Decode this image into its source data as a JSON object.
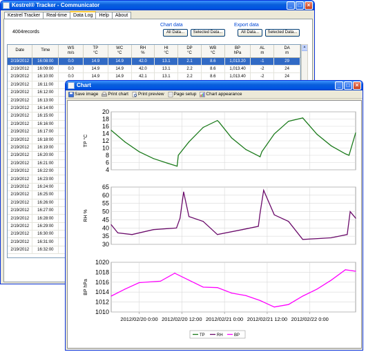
{
  "main_window": {
    "title": "Kestrel® Tracker - Communicator",
    "tabs": [
      "Kestrel Tracker",
      "Real-time",
      "Data Log",
      "Help",
      "About"
    ],
    "active_tab": "Data Log",
    "record_count": "4004records",
    "chart_data_label": "Chart data",
    "export_data_label": "Export data",
    "buttons": {
      "chart_all": "All Data...",
      "chart_selected": "Selected Data...",
      "export_all": "All Data...",
      "export_selected": "Selected Data..."
    },
    "table": {
      "columns": [
        "Date",
        "Time",
        "WS\nm/s",
        "TP\n°C",
        "WC\n°C",
        "RH\n%",
        "HI\n°C",
        "DP\n°C",
        "WB\n°C",
        "BP\nhPa",
        "AL\nm",
        "DA\nm"
      ],
      "rows": [
        [
          "2/19/2012",
          "16:08:00",
          "0.0",
          "14.9",
          "14.9",
          "42.0",
          "13.1",
          "2.1",
          "8.6",
          "1,013.20",
          "-1",
          "29"
        ],
        [
          "2/19/2012",
          "16:09:00",
          "0.0",
          "14.9",
          "14.9",
          "42.0",
          "13.1",
          "2.2",
          "8.6",
          "1,013.40",
          "-2",
          "24"
        ],
        [
          "2/19/2012",
          "16:10:00",
          "0.0",
          "14.9",
          "14.9",
          "42.1",
          "13.1",
          "2.2",
          "8.6",
          "1,013.40",
          "-2",
          "24"
        ],
        [
          "2/19/2012",
          "16:11:00"
        ],
        [
          "2/19/2012",
          "16:12:00"
        ],
        [
          "2/19/2012",
          "16:13:00"
        ],
        [
          "2/19/2012",
          "16:14:00"
        ],
        [
          "2/19/2012",
          "16:15:00"
        ],
        [
          "2/19/2012",
          "16:16:00"
        ],
        [
          "2/19/2012",
          "16:17:00"
        ],
        [
          "2/19/2012",
          "16:18:00"
        ],
        [
          "2/19/2012",
          "16:19:00"
        ],
        [
          "2/19/2012",
          "16:20:00"
        ],
        [
          "2/19/2012",
          "16:21:00"
        ],
        [
          "2/19/2012",
          "16:22:00"
        ],
        [
          "2/19/2012",
          "16:23:00"
        ],
        [
          "2/19/2012",
          "16:24:00"
        ],
        [
          "2/19/2012",
          "16:25:00"
        ],
        [
          "2/19/2012",
          "16:26:00"
        ],
        [
          "2/19/2012",
          "16:27:00"
        ],
        [
          "2/19/2012",
          "16:28:00"
        ],
        [
          "2/19/2012",
          "16:29:00"
        ],
        [
          "2/19/2012",
          "16:30:00"
        ],
        [
          "2/19/2012",
          "16:31:00"
        ],
        [
          "2/19/2012",
          "16:32:00"
        ]
      ]
    }
  },
  "chart_window": {
    "title": "Chart",
    "toolbar": [
      "Save image",
      "Print chart",
      "Print preview",
      "Page setup",
      "Chart appearance"
    ]
  },
  "colors": {
    "tp": "#1a7a1a",
    "rh": "#6a0a6a",
    "bp": "#ff00ff"
  },
  "chart_data": [
    {
      "type": "line",
      "ylabel": "TP °C",
      "ylim": [
        4,
        20
      ],
      "yticks": [
        4,
        6,
        8,
        10,
        12,
        14,
        16,
        18,
        20
      ],
      "x_range": [
        "2012-02-19 16:08",
        "2012-02-22 12:52"
      ],
      "series": [
        {
          "name": "TP",
          "x": [
            "2012-02-19 16:08",
            "2012-02-19 20:00",
            "2012-02-20 00:00",
            "2012-02-20 04:00",
            "2012-02-20 08:00",
            "2012-02-20 10:40",
            "2012-02-20 11:00",
            "2012-02-20 14:00",
            "2012-02-20 18:00",
            "2012-02-20 22:00",
            "2012-02-20 22:30",
            "2012-02-21 02:00",
            "2012-02-21 06:00",
            "2012-02-21 10:00",
            "2012-02-21 10:30",
            "2012-02-21 14:00",
            "2012-02-21 18:00",
            "2012-02-21 22:00",
            "2012-02-22 02:00",
            "2012-02-22 06:00",
            "2012-02-22 10:00",
            "2012-02-22 11:00",
            "2012-02-22 12:52"
          ],
          "y": [
            14.9,
            11.7,
            9.0,
            7.1,
            5.8,
            5.0,
            8.0,
            11.7,
            15.7,
            17.6,
            17.1,
            12.8,
            9.6,
            7.6,
            9.0,
            13.9,
            17.4,
            18.3,
            13.8,
            10.6,
            8.4,
            8.0,
            14.2
          ]
        }
      ]
    },
    {
      "type": "line",
      "ylabel": "RH %",
      "ylim": [
        30,
        65
      ],
      "yticks": [
        30,
        35,
        40,
        45,
        50,
        55,
        60,
        65
      ],
      "x_range": [
        "2012-02-19 16:08",
        "2012-02-22 12:52"
      ],
      "series": [
        {
          "name": "RH",
          "x": [
            "2012-02-19 16:08",
            "2012-02-19 18:00",
            "2012-02-19 22:00",
            "2012-02-20 04:00",
            "2012-02-20 10:30",
            "2012-02-20 11:30",
            "2012-02-20 12:30",
            "2012-02-20 14:00",
            "2012-02-20 18:00",
            "2012-02-20 22:00",
            "2012-02-21 05:00",
            "2012-02-21 09:30",
            "2012-02-21 10:00",
            "2012-02-21 11:00",
            "2012-02-21 14:00",
            "2012-02-21 18:00",
            "2012-02-21 22:00",
            "2012-02-22 06:00",
            "2012-02-22 10:30",
            "2012-02-22 11:20",
            "2012-02-22 12:52"
          ],
          "y": [
            42,
            37,
            36,
            39,
            40,
            46,
            62,
            47,
            44,
            36,
            39,
            41,
            49,
            63,
            48,
            44,
            33,
            34,
            36,
            50,
            46
          ]
        }
      ]
    },
    {
      "type": "line",
      "ylabel": "BP hPa",
      "ylim": [
        1010,
        1020
      ],
      "yticks": [
        1010,
        1012,
        1014,
        1016,
        1018,
        1020
      ],
      "xticks": [
        "2012/02/20 0:00",
        "2012/02/20 12:00",
        "2012/02/21 0:00",
        "2012/02/21 12:00",
        "2012/02/22 0:00"
      ],
      "x_range": [
        "2012-02-19 16:08",
        "2012-02-22 12:52"
      ],
      "series": [
        {
          "name": "BP",
          "x": [
            "2012-02-19 16:08",
            "2012-02-19 20:00",
            "2012-02-20 00:00",
            "2012-02-20 06:00",
            "2012-02-20 10:00",
            "2012-02-20 14:00",
            "2012-02-20 18:00",
            "2012-02-20 22:00",
            "2012-02-21 02:00",
            "2012-02-21 06:00",
            "2012-02-21 10:00",
            "2012-02-21 14:00",
            "2012-02-21 18:00",
            "2012-02-21 22:00",
            "2012-02-22 02:00",
            "2012-02-22 06:00",
            "2012-02-22 10:00",
            "2012-02-22 12:52"
          ],
          "y": [
            1013.2,
            1014.6,
            1015.9,
            1016.2,
            1017.8,
            1016.4,
            1015.0,
            1014.9,
            1013.8,
            1013.3,
            1012.3,
            1011.0,
            1011.5,
            1013.2,
            1014.6,
            1016.4,
            1018.5,
            1018.2
          ]
        }
      ]
    }
  ],
  "legend": [
    "TP",
    "RH",
    "BP"
  ]
}
